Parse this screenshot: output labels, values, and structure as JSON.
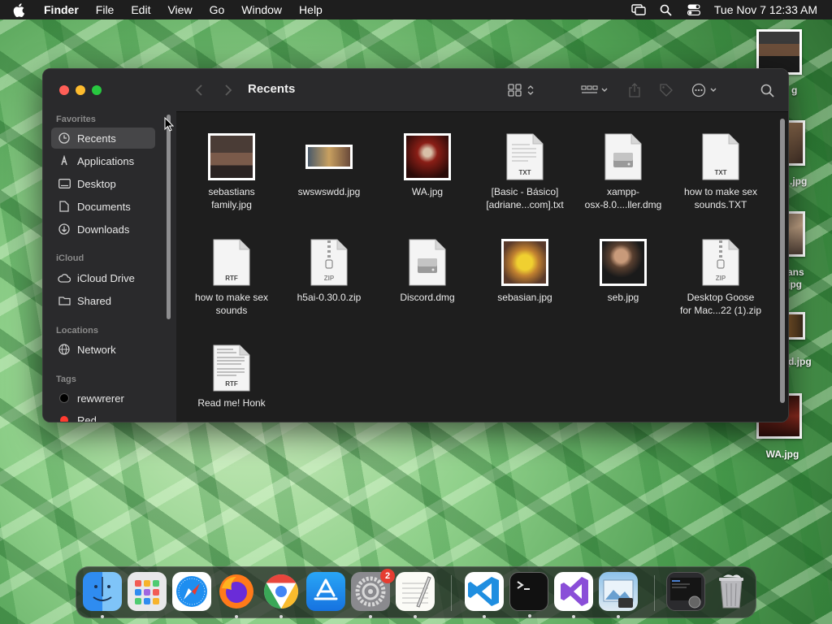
{
  "menubar": {
    "app_name": "Finder",
    "items": [
      "File",
      "Edit",
      "View",
      "Go",
      "Window",
      "Help"
    ],
    "clock": "Tue Nov 7  12:33 AM"
  },
  "desktop": {
    "items": [
      {
        "label": "g"
      },
      {
        "label": ".jpg"
      },
      {
        "label": "ans\njpg"
      },
      {
        "label": "d.jpg"
      },
      {
        "label": "WA.jpg"
      }
    ]
  },
  "finder": {
    "title": "Recents",
    "sidebar": {
      "favorites_header": "Favorites",
      "favorites": [
        {
          "label": "Recents"
        },
        {
          "label": "Applications"
        },
        {
          "label": "Desktop"
        },
        {
          "label": "Documents"
        },
        {
          "label": "Downloads"
        }
      ],
      "icloud_header": "iCloud",
      "icloud": [
        {
          "label": "iCloud Drive"
        },
        {
          "label": "Shared"
        }
      ],
      "locations_header": "Locations",
      "locations": [
        {
          "label": "Network"
        }
      ],
      "tags_header": "Tags",
      "tags": [
        {
          "label": "rewwrerer",
          "color": "#000000"
        },
        {
          "label": "Red",
          "color": "#ff3b30"
        }
      ]
    },
    "files": [
      {
        "name": "sebastians\nfamily.jpg",
        "kind": "photo"
      },
      {
        "name": "swswswdd.jpg",
        "kind": "photo-wide"
      },
      {
        "name": "WA.jpg",
        "kind": "poster"
      },
      {
        "name": "[Basic - Básico]\n[adriane...com].txt",
        "kind": "doc",
        "ext": "TXT"
      },
      {
        "name": "xampp-\nosx-8.0....ller.dmg",
        "kind": "dmg"
      },
      {
        "name": "how to make sex\nsounds.TXT",
        "kind": "doc",
        "ext": "TXT"
      },
      {
        "name": "how to make sex\nsounds",
        "kind": "doc",
        "ext": "RTF"
      },
      {
        "name": "h5ai-0.30.0.zip",
        "kind": "zip",
        "ext": "ZIP"
      },
      {
        "name": "Discord.dmg",
        "kind": "dmg"
      },
      {
        "name": "sebasian.jpg",
        "kind": "face"
      },
      {
        "name": "seb.jpg",
        "kind": "portrait"
      },
      {
        "name": "Desktop Goose\nfor Mac...22 (1).zip",
        "kind": "zip",
        "ext": "ZIP"
      },
      {
        "name": "Read me! Honk",
        "kind": "doc-lines",
        "ext": "RTF"
      }
    ]
  },
  "dock": {
    "apps": [
      {
        "name": "Finder"
      },
      {
        "name": "Launchpad"
      },
      {
        "name": "Safari"
      },
      {
        "name": "Firefox"
      },
      {
        "name": "Chrome"
      },
      {
        "name": "App Store"
      },
      {
        "name": "System Settings",
        "badge": "2"
      },
      {
        "name": "TextEdit"
      },
      {
        "name": "Visual Studio Code"
      },
      {
        "name": "Terminal"
      },
      {
        "name": "Visual Studio"
      },
      {
        "name": "Preview"
      },
      {
        "name": "Downloads"
      },
      {
        "name": "Trash"
      }
    ]
  }
}
